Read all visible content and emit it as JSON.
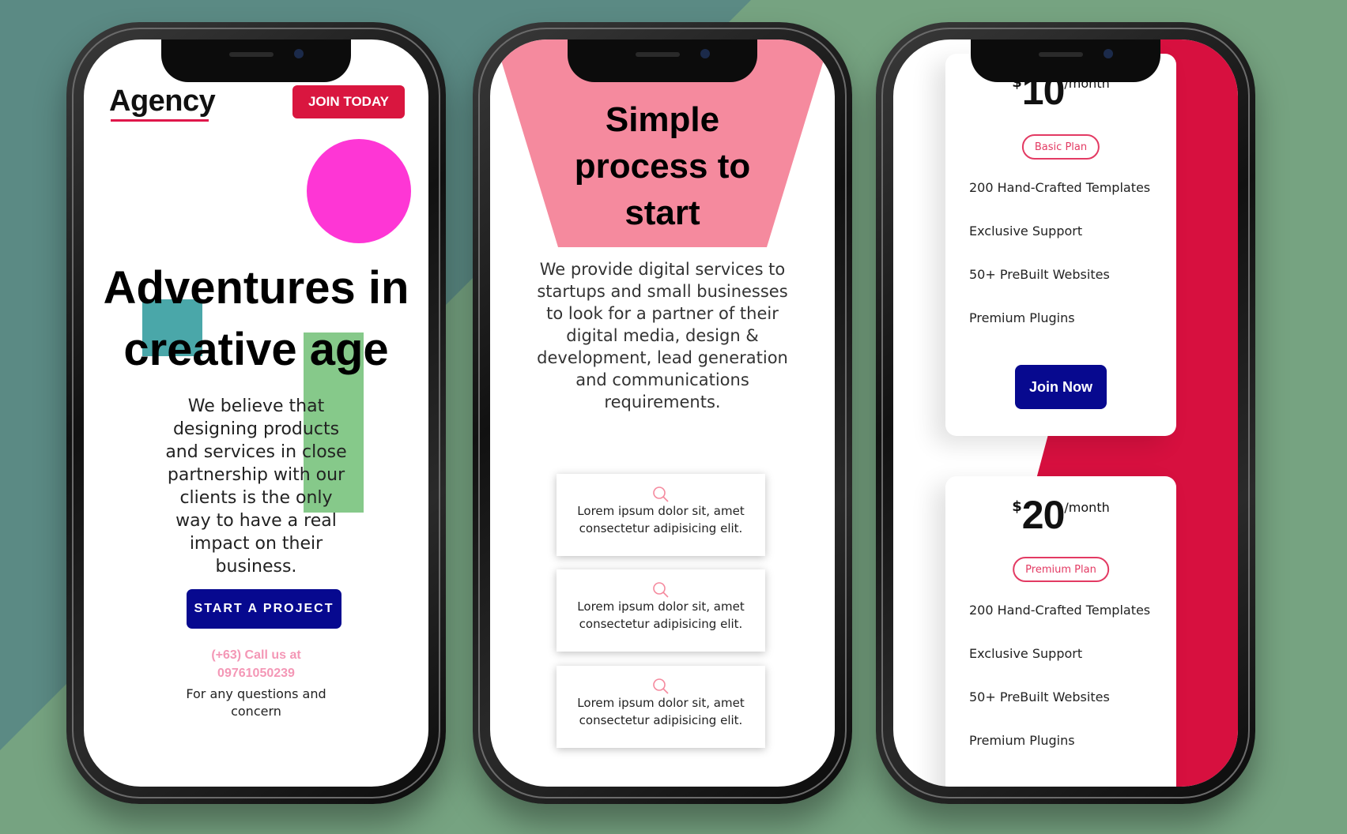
{
  "colors": {
    "background_green": "#76a381",
    "background_teal": "#5b8a84",
    "brand_red": "#d9163f",
    "brand_navy": "#07098f",
    "pink": "#f58a9e",
    "magenta": "#fe36d5"
  },
  "phone1": {
    "logo": "Agency",
    "join_button": "JOIN TODAY",
    "hero_title_line1": "Adventures in",
    "hero_title_line2": "creative age",
    "description": "We believe that designing products and services in close partnership with our clients is the only way to have a real impact on their business.",
    "cta_button": "START A PROJECT",
    "call_text": "(+63) Call us at 09761050239",
    "note": "For any questions and concern"
  },
  "phone2": {
    "title_line1": "Simple",
    "title_line2": "process to",
    "title_line3": "start",
    "description": "We provide digital services to startups and small businesses to look for a partner of their digital media, design & development, lead generation and communications requirements.",
    "cards": [
      {
        "icon": "search-icon",
        "text_line1": "Lorem ipsum dolor sit, amet",
        "text_line2": "consectetur adipisicing elit."
      },
      {
        "icon": "search-icon",
        "text_line1": "Lorem ipsum dolor sit, amet",
        "text_line2": "consectetur adipisicing elit."
      },
      {
        "icon": "search-icon",
        "text_line1": "Lorem ipsum dolor sit, amet",
        "text_line2": "consectetur adipisicing elit."
      }
    ]
  },
  "phone3": {
    "plans": [
      {
        "currency": "$",
        "amount": "10",
        "period": "/month",
        "badge": "Basic Plan",
        "features": [
          "200 Hand-Crafted Templates",
          "Exclusive Support",
          "50+ PreBuilt Websites",
          "Premium Plugins"
        ],
        "button": "Join Now"
      },
      {
        "currency": "$",
        "amount": "20",
        "period": "/month",
        "badge": "Premium Plan",
        "features": [
          "200 Hand-Crafted Templates",
          "Exclusive Support",
          "50+ PreBuilt Websites",
          "Premium Plugins"
        ]
      }
    ]
  }
}
